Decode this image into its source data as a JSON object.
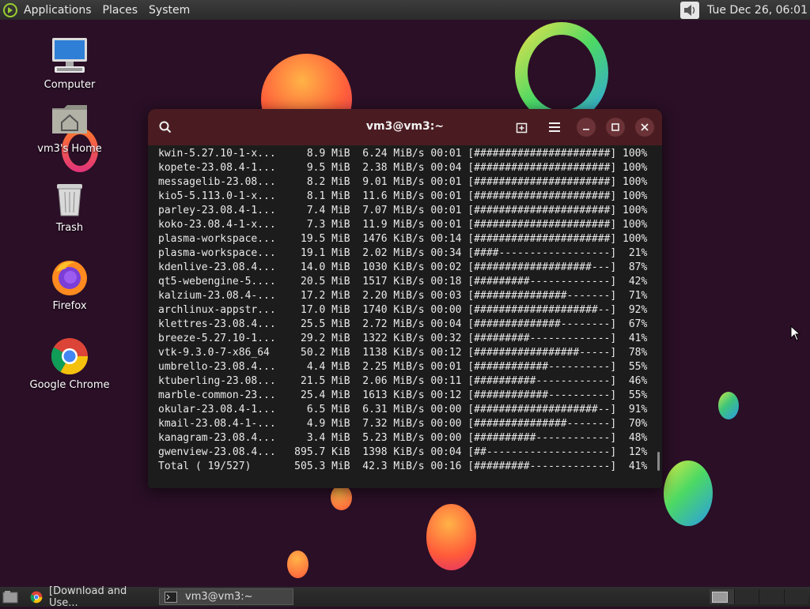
{
  "top_panel": {
    "menus": [
      "Applications",
      "Places",
      "System"
    ],
    "clock": "Tue Dec 26, 06:01"
  },
  "desktop_icons": [
    {
      "label": "Computer",
      "icon": "computer-icon"
    },
    {
      "label": "vm3's Home",
      "icon": "home-folder-icon"
    },
    {
      "label": "Trash",
      "icon": "trash-icon"
    },
    {
      "label": "Firefox",
      "icon": "firefox-icon"
    },
    {
      "label": "Google Chrome",
      "icon": "chrome-icon"
    }
  ],
  "terminal": {
    "title": "vm3@vm3:~",
    "lines": [
      "kwin-5.27.10-1-x...     8.9 MiB  6.24 MiB/s 00:01 [######################] 100%",
      "kopete-23.08.4-1...     9.5 MiB  2.38 MiB/s 00:04 [######################] 100%",
      "messagelib-23.08...     8.2 MiB  9.01 MiB/s 00:01 [######################] 100%",
      "kio5-5.113.0-1-x...     8.1 MiB  11.6 MiB/s 00:01 [######################] 100%",
      "parley-23.08.4-1...     7.4 MiB  7.07 MiB/s 00:01 [######################] 100%",
      "koko-23.08.4-1-x...     7.3 MiB  11.9 MiB/s 00:01 [######################] 100%",
      "plasma-workspace...    19.5 MiB  1476 KiB/s 00:14 [######################] 100%",
      "plasma-workspace...    19.1 MiB  2.02 MiB/s 00:34 [####------------------]  21%",
      "kdenlive-23.08.4...    14.0 MiB  1030 KiB/s 00:02 [###################---]  87%",
      "qt5-webengine-5....    20.5 MiB  1517 KiB/s 00:18 [#########-------------]  42%",
      "kalzium-23.08.4-...    17.2 MiB  2.20 MiB/s 00:03 [###############-------]  71%",
      "archlinux-appstr...    17.0 MiB  1740 KiB/s 00:00 [####################--]  92%",
      "klettres-23.08.4...    25.5 MiB  2.72 MiB/s 00:04 [##############--------]  67%",
      "breeze-5.27.10-1...    29.2 MiB  1322 KiB/s 00:32 [#########-------------]  41%",
      "vtk-9.3.0-7-x86_64     50.2 MiB  1138 KiB/s 00:12 [#################-----]  78%",
      "umbrello-23.08.4...     4.4 MiB  2.25 MiB/s 00:01 [############----------]  55%",
      "ktuberling-23.08...    21.5 MiB  2.06 MiB/s 00:11 [##########------------]  46%",
      "marble-common-23...    25.4 MiB  1613 KiB/s 00:12 [############----------]  55%",
      "okular-23.08.4-1...     6.5 MiB  6.31 MiB/s 00:00 [####################--]  91%",
      "kmail-23.08.4-1-...     4.9 MiB  7.32 MiB/s 00:00 [###############-------]  70%",
      "kanagram-23.08.4...     3.4 MiB  5.23 MiB/s 00:00 [##########------------]  48%",
      "gwenview-23.08.4...   895.7 KiB  1398 KiB/s 00:04 [##--------------------]  12%",
      "Total ( 19/527)       505.3 MiB  42.3 MiB/s 00:16 [#########-------------]  41%"
    ]
  },
  "taskbar": {
    "items": [
      {
        "label": "[Download and Use...",
        "icon": "chrome-icon"
      },
      {
        "label": "vm3@vm3:~",
        "icon": "terminal-icon"
      }
    ]
  }
}
